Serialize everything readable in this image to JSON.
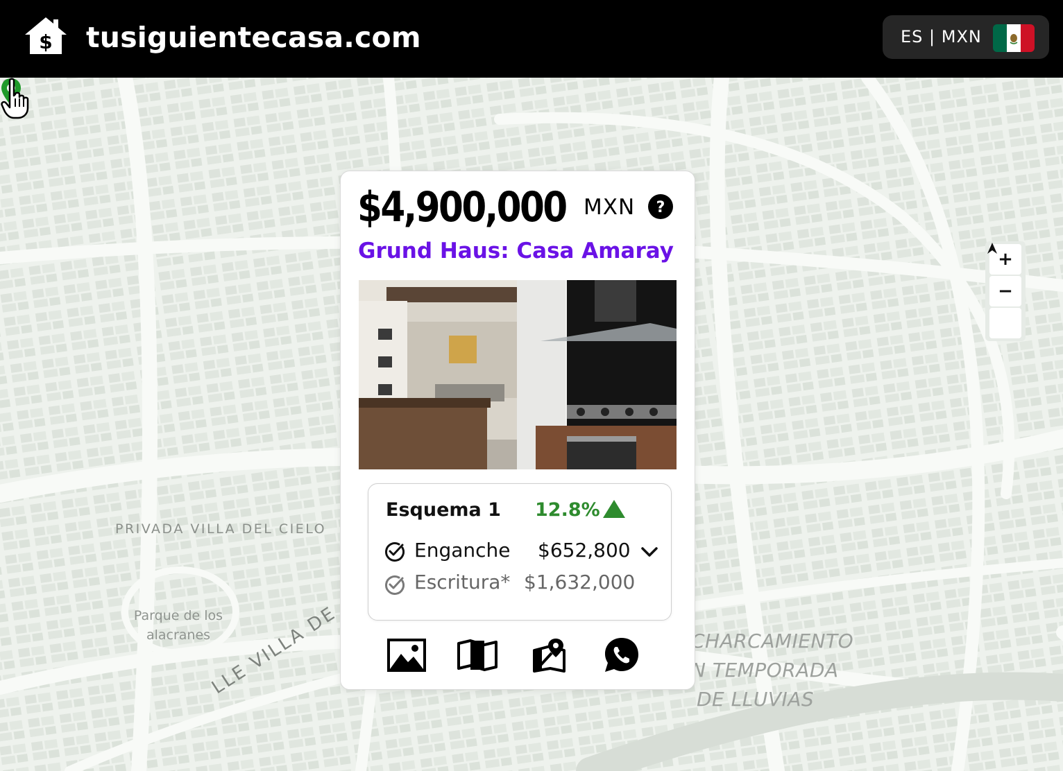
{
  "header": {
    "site_name": "tusiguientecasa.com",
    "locale_label": "ES | MXN",
    "flag_colors": [
      "#006847",
      "#ffffff",
      "#ce1126"
    ]
  },
  "map": {
    "street_label": "PRIVADA VILLA DEL CIELO",
    "park_label": "Parque de los alacranes",
    "event_label_lines": [
      "CHARCAMIENTO",
      "N TEMPORADA",
      "DE LLUVIAS"
    ],
    "road_label": "LLE VILLA DE",
    "zoom_in": "+",
    "zoom_out": "−",
    "compass": "⮝"
  },
  "card": {
    "price": "$4,900,000",
    "currency": "MXN",
    "title": "Grund Haus: Casa Amaray",
    "scheme": {
      "name": "Esquema 1",
      "rate": "12.8%",
      "rows": [
        {
          "label": "Enganche",
          "value": "$652,800"
        },
        {
          "label": "Escritura*",
          "value": "$1,632,000"
        }
      ]
    },
    "actions": [
      "gallery-icon",
      "map-icon",
      "location-icon",
      "whatsapp-icon"
    ]
  },
  "colors": {
    "accent_purple": "#6a12e6",
    "positive_green": "#2e8b2e",
    "pin_green": "#1f9a2a"
  }
}
